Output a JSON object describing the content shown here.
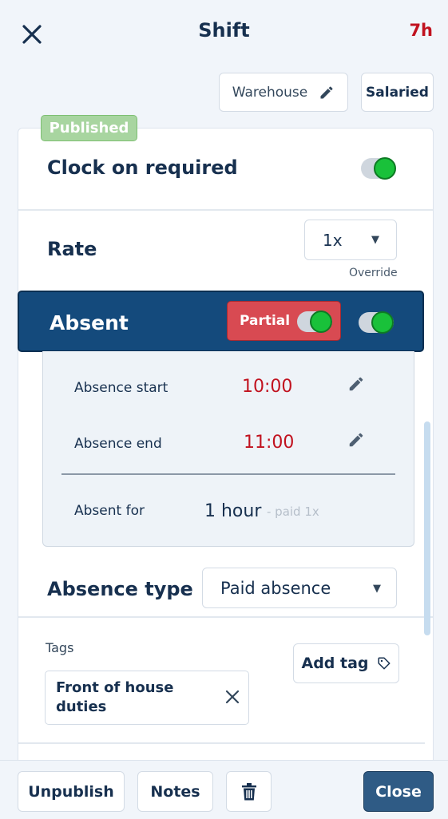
{
  "header": {
    "title": "Shift",
    "hours": "7h"
  },
  "top_pills": {
    "location": "Warehouse",
    "pay_type": "Salaried"
  },
  "card": {
    "status_badge": "Published",
    "clock_on": {
      "label": "Clock on required",
      "enabled": true
    },
    "rate": {
      "label": "Rate",
      "selected": "1x",
      "sublabel": "Override"
    },
    "absent": {
      "label": "Absent",
      "partial_label": "Partial",
      "partial_enabled": true,
      "enabled": true
    },
    "absence_details": {
      "start_label": "Absence start",
      "start_time": "10:00",
      "end_label": "Absence end",
      "end_time": "11:00",
      "absent_for_label": "Absent for",
      "absent_for_value": "1 hour",
      "absent_for_note": "- paid 1x"
    },
    "absence_type": {
      "label": "Absence type",
      "selected": "Paid absence"
    },
    "tags": {
      "label": "Tags",
      "add_button": "Add tag",
      "items": [
        "Front of house duties"
      ]
    }
  },
  "footer": {
    "unpublish": "Unpublish",
    "notes": "Notes",
    "close": "Close"
  },
  "colors": {
    "accent_red": "#c1121f",
    "absent_band": "#144a7c",
    "toggle_on": "#19c13a",
    "close_button": "#2f5b85"
  }
}
